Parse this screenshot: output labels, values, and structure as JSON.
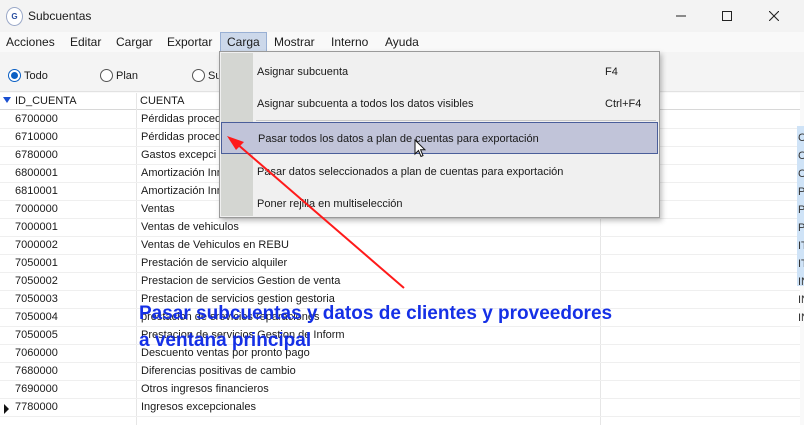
{
  "window": {
    "title": "Subcuentas",
    "app_icon_text": "G"
  },
  "menubar": {
    "items": [
      "Acciones",
      "Editar",
      "Cargar",
      "Exportar",
      "Carga",
      "Mostrar",
      "Interno",
      "Ayuda"
    ]
  },
  "filters": {
    "options": [
      "Todo",
      "Plan",
      "Su"
    ],
    "selected": "Todo"
  },
  "grid": {
    "columns": [
      "ID_CUENTA",
      "CUENTA"
    ],
    "rows": [
      {
        "id": "6700000",
        "cuenta": "Pérdidas proced"
      },
      {
        "id": "6710000",
        "cuenta": "Pérdidas proced"
      },
      {
        "id": "6780000",
        "cuenta": "Gastos excepci"
      },
      {
        "id": "6800001",
        "cuenta": "Amortización Inn"
      },
      {
        "id": "6810001",
        "cuenta": "Amortización Inn"
      },
      {
        "id": "7000000",
        "cuenta": "Ventas"
      },
      {
        "id": "7000001",
        "cuenta": "Ventas de vehiculos"
      },
      {
        "id": "7000002",
        "cuenta": "Ventas de Vehiculos  en REBU"
      },
      {
        "id": "7050001",
        "cuenta": "Prestación de servicio alquiler"
      },
      {
        "id": "7050002",
        "cuenta": "Prestacion de servicios Gestion de venta"
      },
      {
        "id": "7050003",
        "cuenta": "Prestacion de servicios gestion gestoria"
      },
      {
        "id": "7050004",
        "cuenta": "prestacion de srevicios reparaciones"
      },
      {
        "id": "7050005",
        "cuenta": "Prestacion de servicios Gestion de Inform"
      },
      {
        "id": "7060000",
        "cuenta": "Descuento ventas por pronto pago"
      },
      {
        "id": "7680000",
        "cuenta": "Diferencias positivas de cambio"
      },
      {
        "id": "7690000",
        "cuenta": "Otros ingresos financieros"
      },
      {
        "id": "7780000",
        "cuenta": "Ingresos excepcionales"
      }
    ],
    "current_row": "7780000",
    "right_edge_glyphs": [
      "CI",
      "CI",
      "CI",
      "P",
      "P",
      "P",
      "IT",
      "IT",
      "IN",
      "IN",
      "IN"
    ]
  },
  "dropdown": {
    "items": [
      {
        "label": "Asignar subcuenta",
        "shortcut": "F4"
      },
      {
        "label": "Asignar subcuenta a todos los datos visibles",
        "shortcut": "Ctrl+F4"
      },
      {
        "label": "Pasar todos los datos a plan de cuentas para exportación",
        "shortcut": ""
      },
      {
        "label": "Pasar datos seleccionados a plan de cuentas para exportación",
        "shortcut": ""
      },
      {
        "label": "Poner rejilla en multiselección",
        "shortcut": ""
      }
    ],
    "highlighted": "Pasar todos los datos a plan de cuentas para exportación"
  },
  "annotation": {
    "line1": "Pasar subcuentas y datos de clientes y proveedores",
    "line2": "a ventana principal",
    "color": "#1530e6"
  },
  "colors": {
    "arrow": "#ff1a1a",
    "highlight": "#c1c4d9",
    "menu_active": "#ccd8ea"
  }
}
